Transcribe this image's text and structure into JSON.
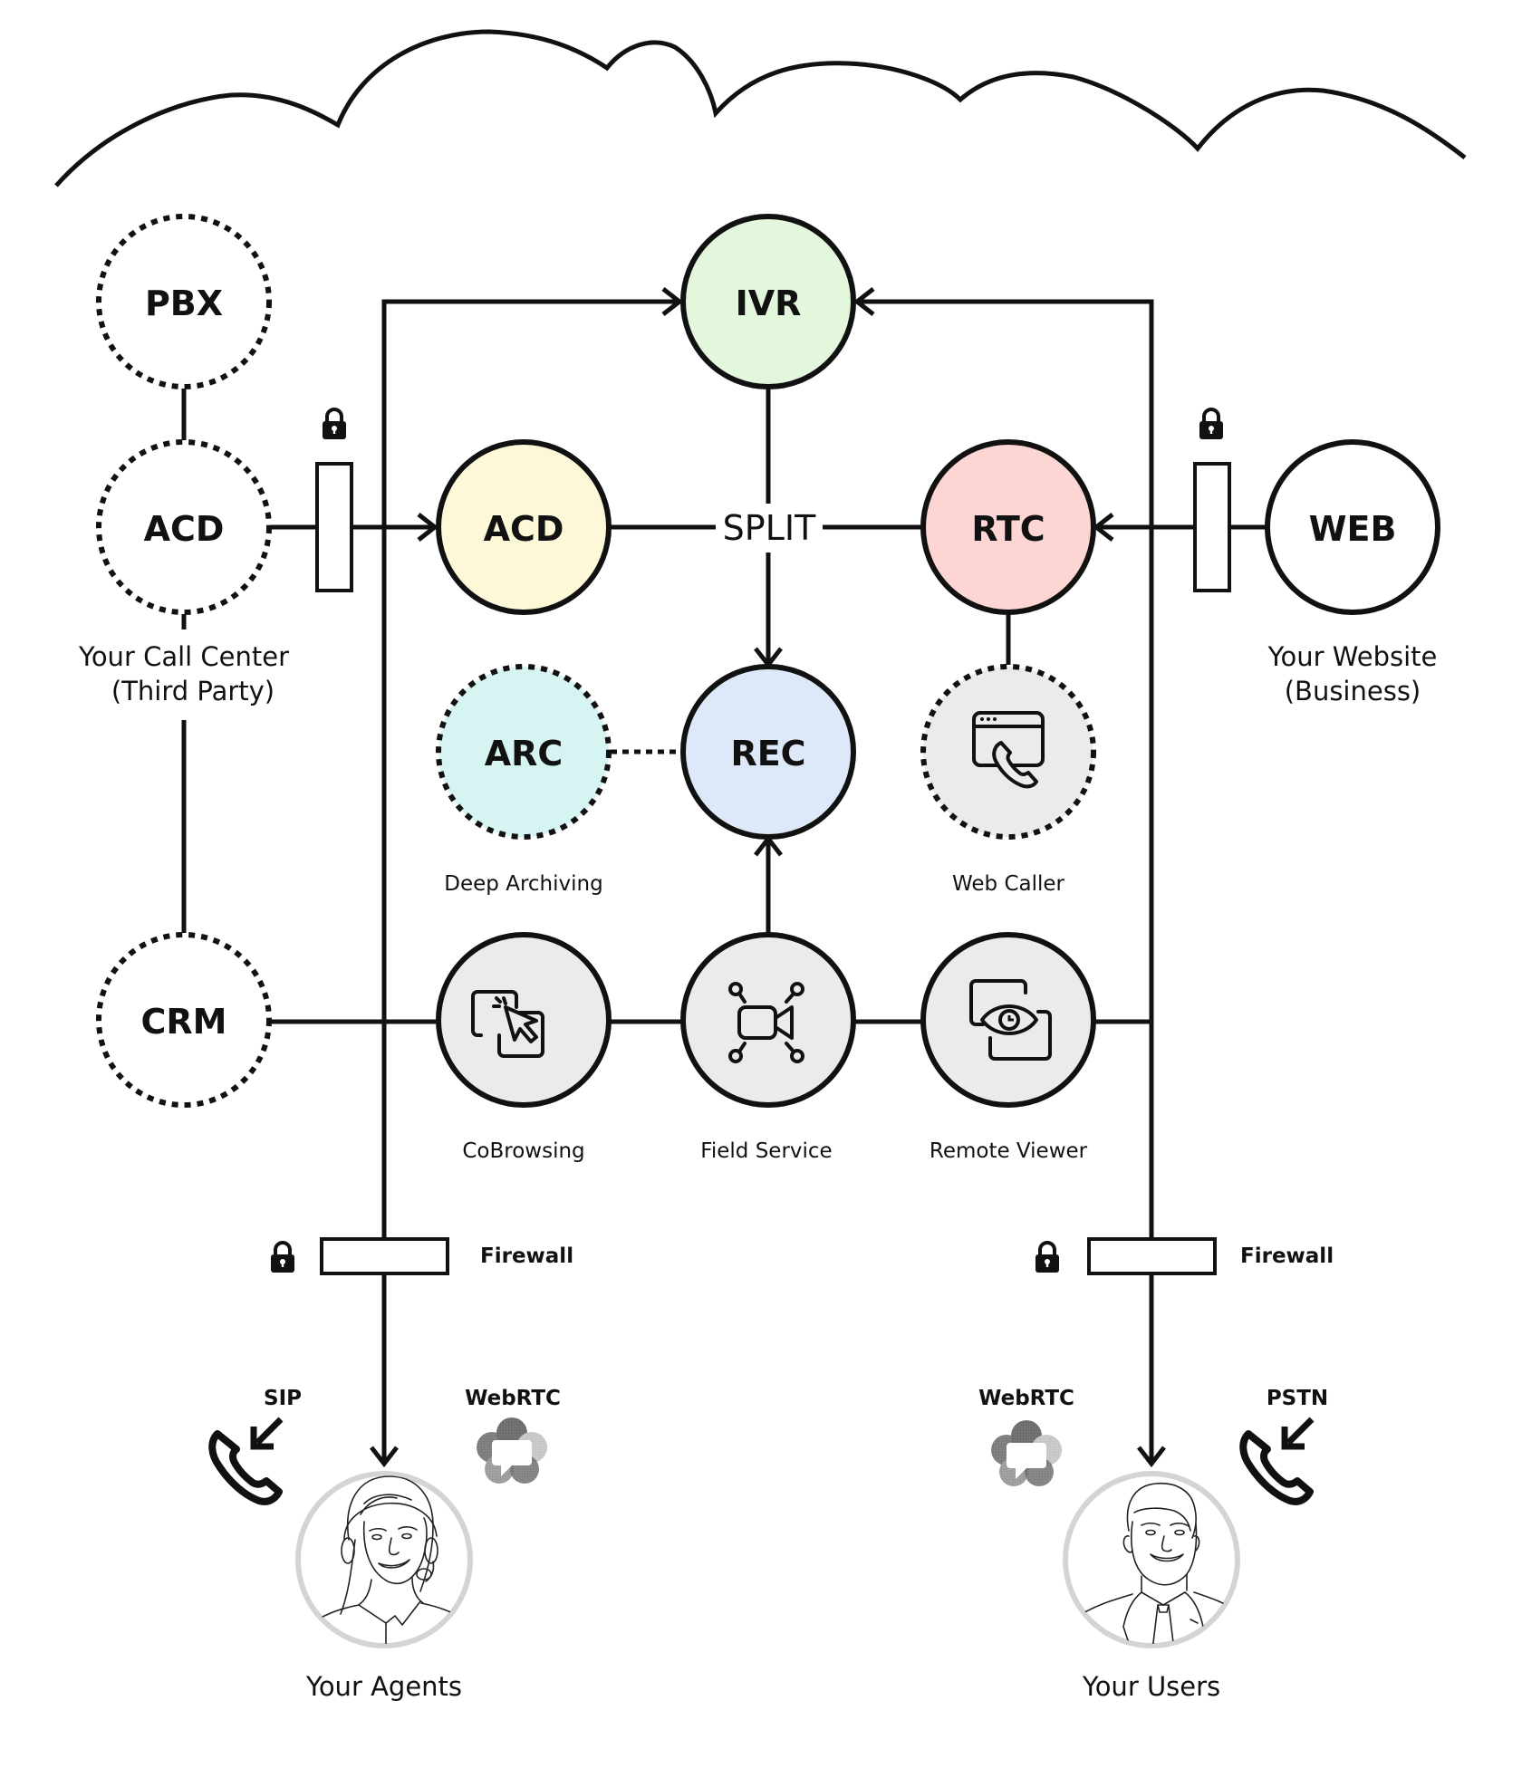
{
  "diagram": {
    "nodes": {
      "pbx": {
        "label": "PBX",
        "fill": "#ffffff",
        "style": "dotted"
      },
      "acd_third_party": {
        "label": "ACD",
        "fill": "#ffffff",
        "style": "dotted"
      },
      "crm": {
        "label": "CRM",
        "fill": "#ffffff",
        "style": "dotted"
      },
      "ivr": {
        "label": "IVR",
        "fill": "#e2f7dc",
        "style": "solid"
      },
      "acd": {
        "label": "ACD",
        "fill": "#fdf8d8",
        "style": "solid"
      },
      "rtc": {
        "label": "RTC",
        "fill": "#fdd5d2",
        "style": "solid"
      },
      "web": {
        "label": "WEB",
        "fill": "#ffffff",
        "style": "solid"
      },
      "arc": {
        "label": "ARC",
        "fill": "#d6f4f2",
        "style": "dotted",
        "caption": "Deep Archiving"
      },
      "rec": {
        "label": "REC",
        "fill": "#dde9f8",
        "style": "solid"
      },
      "web_caller": {
        "label": "",
        "fill": "#ebebeb",
        "style": "dotted",
        "icon": "browser-phone-icon",
        "caption": "Web Caller"
      },
      "cobrowsing": {
        "label": "",
        "fill": "#ebebeb",
        "style": "solid",
        "icon": "cobrowse-cursor-icon",
        "caption": "CoBrowsing"
      },
      "field_service": {
        "label": "",
        "fill": "#ebebeb",
        "style": "solid",
        "icon": "video-camera-network-icon",
        "caption": "Field Service"
      },
      "remote_viewer": {
        "label": "",
        "fill": "#ebebeb",
        "style": "solid",
        "icon": "screen-eye-icon",
        "caption": "Remote Viewer"
      }
    },
    "split_label": "SPLIT",
    "call_center_label": [
      "Your Call Center",
      "(Third Party)"
    ],
    "website_label": [
      "Your Website",
      "(Business)"
    ],
    "firewall_label": "Firewall",
    "agents": {
      "label": "Your Agents",
      "protocols": [
        {
          "label": "SIP",
          "icon": "incoming-call-icon"
        },
        {
          "label": "WebRTC",
          "icon": "webrtc-logo-icon"
        }
      ]
    },
    "users": {
      "label": "Your Users",
      "protocols": [
        {
          "label": "WebRTC",
          "icon": "webrtc-logo-icon"
        },
        {
          "label": "PSTN",
          "icon": "incoming-call-icon"
        }
      ]
    }
  }
}
